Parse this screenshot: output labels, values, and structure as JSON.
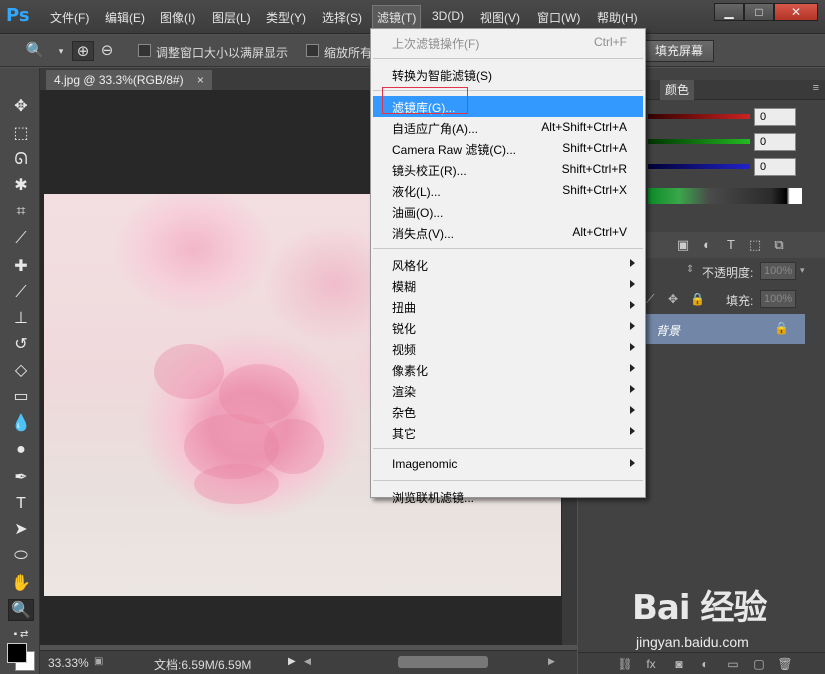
{
  "app": {
    "logo": "Ps"
  },
  "menubar": {
    "items": [
      "文件(F)",
      "编辑(E)",
      "图像(I)",
      "图层(L)",
      "类型(Y)",
      "选择(S)",
      "滤镜(T)",
      "3D(D)",
      "视图(V)",
      "窗口(W)",
      "帮助(H)"
    ],
    "window_controls": {
      "minimize": "▁",
      "maximize": "□",
      "close": "✕"
    }
  },
  "options_bar": {
    "resize_windows_label": "调整窗口大小以满屏显示",
    "zoom_all_label": "缩放所有",
    "fill_screen_button": "填充屏幕"
  },
  "document": {
    "tab_title": "4.jpg @ 33.3%(RGB/8#)",
    "tab_close": "×"
  },
  "status_bar": {
    "zoom": "33.33%",
    "doc_size": "文档:6.59M/6.59M"
  },
  "color_panel": {
    "tab_label": "颜色",
    "values": [
      "0",
      "0",
      "0"
    ],
    "colors": {
      "r": "#cc2222",
      "g": "#22bb22",
      "b": "#2222cc"
    }
  },
  "layers_panel": {
    "opacity_label": "不透明度:",
    "opacity_value": "100%",
    "fill_label": "填充:",
    "fill_value": "100%",
    "layer_name": "背景",
    "highlight_color": "#7287a8"
  },
  "filter_menu": {
    "items": [
      {
        "label": "上次滤镜操作(F)",
        "shortcut": "Ctrl+F",
        "disabled": true
      },
      {
        "separator": true
      },
      {
        "label": "转换为智能滤镜(S)"
      },
      {
        "separator": true
      },
      {
        "label": "滤镜库(G)...",
        "highlight": true
      },
      {
        "label": "自适应广角(A)...",
        "shortcut": "Alt+Shift+Ctrl+A"
      },
      {
        "label": "Camera Raw 滤镜(C)...",
        "shortcut": "Shift+Ctrl+A"
      },
      {
        "label": "镜头校正(R)...",
        "shortcut": "Shift+Ctrl+R"
      },
      {
        "label": "液化(L)...",
        "shortcut": "Shift+Ctrl+X"
      },
      {
        "label": "油画(O)..."
      },
      {
        "label": "消失点(V)...",
        "shortcut": "Alt+Ctrl+V"
      },
      {
        "separator": true
      },
      {
        "label": "风格化",
        "submenu": true
      },
      {
        "label": "模糊",
        "submenu": true
      },
      {
        "label": "扭曲",
        "submenu": true
      },
      {
        "label": "锐化",
        "submenu": true
      },
      {
        "label": "视频",
        "submenu": true
      },
      {
        "label": "像素化",
        "submenu": true
      },
      {
        "label": "渲染",
        "submenu": true
      },
      {
        "label": "杂色",
        "submenu": true
      },
      {
        "label": "其它",
        "submenu": true
      },
      {
        "separator": true
      },
      {
        "label": "Imagenomic",
        "submenu": true
      },
      {
        "separator": true
      },
      {
        "label": "浏览联机滤镜..."
      }
    ],
    "highlight_color": "#3399ff",
    "annotation_color": "#e0344a"
  },
  "watermark": {
    "main": "Bai 经验",
    "sub": "jingyan.baidu.com"
  }
}
